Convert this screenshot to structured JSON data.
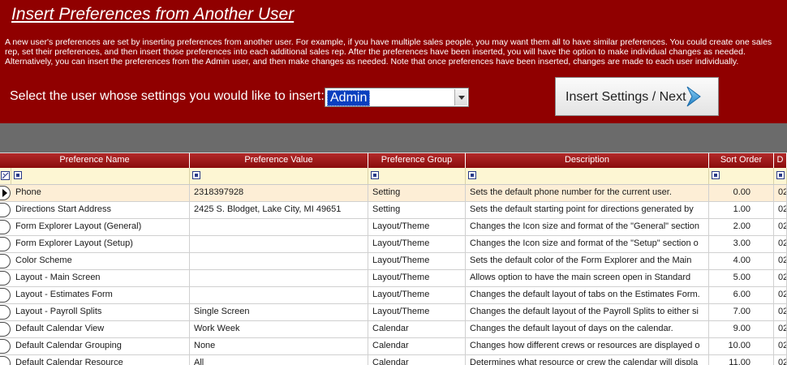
{
  "header": {
    "title": "Insert Preferences from Another User",
    "description": "A new user's preferences are set by inserting preferences from another user. For example, if you have multiple sales people, you may want them all to have similar preferences. You could create one sales rep, set their preferences, and then insert those preferences into each additional sales rep. After the preferences have been inserted, you will have the option to make individual changes as needed. Alternatively, you can insert the preferences from the Admin user, and then make changes as needed. Note that once preferences have been inserted, changes are made to each user individually.",
    "prompt": "Select the user whose settings you would like to insert:",
    "user_select": {
      "value": "Admin"
    },
    "insert_button": "Insert Settings / Next",
    "bg_color": "#900000"
  },
  "grid": {
    "columns": [
      "Preference Name",
      "Preference Value",
      "Preference Group",
      "Description",
      "Sort Order",
      "D"
    ],
    "rows": [
      {
        "name": "Phone",
        "value": "2318397928",
        "group": "Setting",
        "description": "Sets the default phone number for the current user.",
        "sort": "0.00",
        "d": "02/"
      },
      {
        "name": "Directions Start Address",
        "value": "2425 S. Blodget, Lake City, MI 49651",
        "group": "Setting",
        "description": "Sets the default starting point for directions generated by",
        "sort": "1.00",
        "d": "02/"
      },
      {
        "name": "Form Explorer Layout (General)",
        "value": "",
        "group": "Layout/Theme",
        "description": "Changes the Icon size and format of the \"General\" section",
        "sort": "2.00",
        "d": "02/"
      },
      {
        "name": "Form Explorer Layout (Setup)",
        "value": "",
        "group": "Layout/Theme",
        "description": "Changes the Icon size and format of the \"Setup\" section o",
        "sort": "3.00",
        "d": "02/"
      },
      {
        "name": "Color Scheme",
        "value": "",
        "group": "Layout/Theme",
        "description": "Sets the default color of the Form Explorer and the Main",
        "sort": "4.00",
        "d": "02/"
      },
      {
        "name": "Layout - Main Screen",
        "value": "",
        "group": "Layout/Theme",
        "description": "Allows option to have the main screen open in Standard",
        "sort": "5.00",
        "d": "02/"
      },
      {
        "name": "Layout - Estimates Form",
        "value": "",
        "group": "Layout/Theme",
        "description": "Changes the default layout of tabs on the Estimates Form.",
        "sort": "6.00",
        "d": "02/"
      },
      {
        "name": "Layout - Payroll Splits",
        "value": "Single Screen",
        "group": "Layout/Theme",
        "description": "Changes the default layout of the Payroll Splits to either si",
        "sort": "7.00",
        "d": "02/"
      },
      {
        "name": "Default Calendar View",
        "value": "Work Week",
        "group": "Calendar",
        "description": "Changes the default layout of days on the calendar.",
        "sort": "9.00",
        "d": "02/"
      },
      {
        "name": "Default Calendar Grouping",
        "value": "None",
        "group": "Calendar",
        "description": "Changes how different crews or resources are displayed o",
        "sort": "10.00",
        "d": "02/"
      },
      {
        "name": "Default Calendar Resource",
        "value": "All",
        "group": "Calendar",
        "description": "Determines what resource or crew the calendar will displa",
        "sort": "11.00",
        "d": "02/"
      }
    ]
  }
}
